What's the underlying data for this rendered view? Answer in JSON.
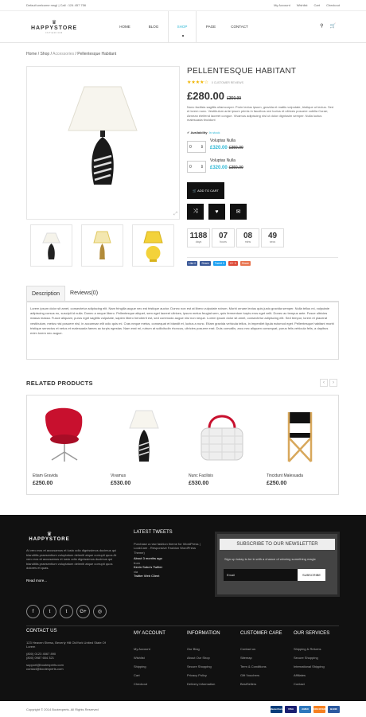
{
  "topbar": {
    "welcome": "Default welcome msg! | Call : 124 457 756",
    "links": [
      "My Account",
      "Wishlist",
      "Cart",
      "Checkout"
    ]
  },
  "logo": {
    "name": "HAPPYSTORE",
    "sub": "INTERIOR"
  },
  "nav": [
    "Home",
    "Blog",
    "Shop",
    "Page",
    "Contact"
  ],
  "nav_active": "Shop",
  "breadcrumb": {
    "home": "Home",
    "shop": "Shop",
    "accessories": "Accessories",
    "current": "Pellentesque Habitant"
  },
  "product": {
    "title": "Pellentesque Habitant",
    "stars": "★★★★☆",
    "reviews": "0 CUSTOMER REVIEWS",
    "price": "£280.00",
    "old_price": "£350.00",
    "description": "Nunc facilisis sagittis ullamcorper. Proin lectus ipsum, gravida et mattis vulputate, tristique ut lectus. Sed et lorem nunc. Vestibulum ante ipsum primis in faucibus orci luctus et ultrices posuere cubilia Curae; Aenean eleifend laoreet congue. Vivamus adipiscing nisl ut dolor dignissim semper. Nulla luctus malesuada tincidunt",
    "availability_label": "Availability",
    "availability": "In stock",
    "options": [
      {
        "name": "Voluptas Nulla",
        "price": "£320.00",
        "old": "£350.00",
        "qty": "0"
      },
      {
        "name": "Voluptas Nulla",
        "price": "£320.00",
        "old": "£350.00",
        "qty": "0"
      }
    ],
    "add_to_cart": "ADD TO CART",
    "countdown": [
      {
        "n": "1188",
        "l": "days"
      },
      {
        "n": "07",
        "l": "hours"
      },
      {
        "n": "08",
        "l": "mins"
      },
      {
        "n": "49",
        "l": "secs"
      }
    ],
    "social": [
      "Like 0",
      "Share",
      "Tweet 0",
      "G+ 0",
      "Share"
    ]
  },
  "tabs": {
    "description": "Description",
    "reviews": "Reviews(0)"
  },
  "tab_body": "Lorem ipsum dolor sit amet, consectetur adipiscing elit. Nam fringilla augue nec est tristique auctor. Donec non est at libero vulputate rutrum. Morbi ornare lectus quis justo gravida semper. Nulla tellus mi, vulputate adipiscing cursus eu, suscipit id nulla. Donec a neque libero. Pellentesque aliquet, sem eget laoreet ultrices, ipsum metus feugiat sem, quis fermentum turpis eros eget velit. Donec ac tempus ante. Fusce ultricies massa massa. Fusce aliquam, purus eget sagittis vulputate, sapien libero hendrerit est, sed commodo augue nisi non neque. Lorem ipsum dolor sit amet, consectetur adipiscing elit. Sed tempor, lorem et placerat vestibulum, metus nisi posuere nisl, in accumsan elit odio quis mi. Cras neque metus, consequat et blandit et, luctus a nunc. Etiam gravida vehicula tellus, in imperdiet ligula euismod eget. Pellentesque habitant morbi tristique senectus et netus et malesuada fames ac turpis egestas. Nam erat mi, rutrum at sollicitudin rhoncus, ultricies posuere erat. Duis convallis, arcu nec aliquam consequat, purus felis vehicula felis, a dapibus enim lorem nec augue.",
  "related": {
    "title": "RELATED PRODUCTS",
    "items": [
      {
        "name": "Etiam Gravida",
        "price": "£250.00"
      },
      {
        "name": "Vivamus",
        "price": "£530.00"
      },
      {
        "name": "Nunc Facilisis",
        "price": "£530.00"
      },
      {
        "name": "Tincidunt Malesuada",
        "price": "£250.00"
      }
    ]
  },
  "footer": {
    "about": "At vero eos et accusamus et iusto odio dignissimos ducimus qui blanditiis praesentium voluptatum deleniti atque corrupti quos At vero eos et accusamus et iusto odio dignissimos ducimus qui blanditiis praesentium voluptatum deleniti atque corrupti quos dolores et quas.",
    "read_more": "Read more...",
    "tweets_title": "LATEST TWEETS",
    "tweets": [
      "Purchase a new fashion theme for WordPress | LookCare - Responsive Fashion WordPress Theme)",
      "About 3 months ago",
      "from",
      "Kevin Sobo's Twitter",
      "via",
      "Twitter Web Client"
    ],
    "news_title": "SUBSCRIBE TO OUR NEWSLETTER",
    "news_text": "Sign up today to be in with a chance of winning something magic",
    "email_placeholder": "Email",
    "subscribe": "SUBSCRIBE",
    "contact_title": "CONTACT US",
    "contact": [
      "123 Heaven Stress, Beverly Hill OldYork United State Of Lorem",
      "(800) 0123 4567 890",
      "(800) 0987 654 321",
      "support@bootexperts.com",
      "contact@bootexperts.com"
    ],
    "cols": [
      {
        "title": "MY ACCOUNT",
        "items": [
          "My Account",
          "Wishlist",
          "Shipping",
          "Cart",
          "Checkout"
        ]
      },
      {
        "title": "INFORMATION",
        "items": [
          "Our Blog",
          "About Our Shop",
          "Secure Shopping",
          "Privacy Policy",
          "Delivery information"
        ]
      },
      {
        "title": "CUSTOMER CARE",
        "items": [
          "Contact us",
          "Sitemap",
          "Term & Conditions",
          "Gift Vouchers",
          "BestSellers"
        ]
      },
      {
        "title": "OUR SERVICES",
        "items": [
          "Shipping & Returns",
          "Secure Shopping",
          "International Shipping",
          "Affiliates",
          "Contact"
        ]
      }
    ],
    "copyright": "Copyright © 2014 Bootexperts. All Rights Reserved",
    "cards": [
      "MasterCard",
      "VISA",
      "AMEX",
      "DISCOVER",
      "BANK"
    ]
  }
}
